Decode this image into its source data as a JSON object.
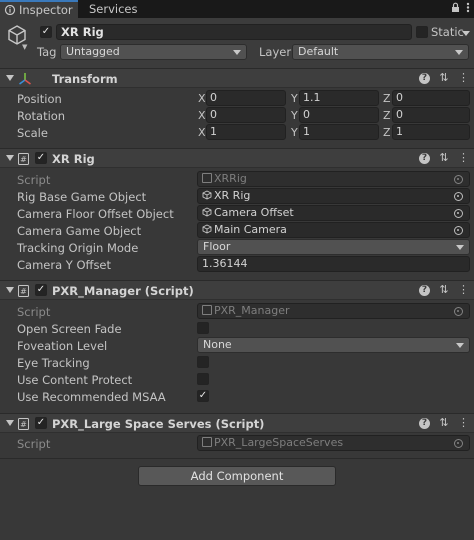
{
  "tabs": [
    {
      "label": "Inspector",
      "icon": "info-icon",
      "active": true
    },
    {
      "label": "Services",
      "active": false
    }
  ],
  "gameobject": {
    "name": "XR Rig",
    "static_label": "Static",
    "tag_label": "Tag",
    "tag_value": "Untagged",
    "layer_label": "Layer",
    "layer_value": "Default"
  },
  "transform": {
    "title": "Transform",
    "position": {
      "label": "Position",
      "x": "0",
      "y": "1.1",
      "z": "0"
    },
    "rotation": {
      "label": "Rotation",
      "x": "0",
      "y": "0",
      "z": "0"
    },
    "scale": {
      "label": "Scale",
      "x": "1",
      "y": "1",
      "z": "1"
    },
    "axis_x": "X",
    "axis_y": "Y",
    "axis_z": "Z"
  },
  "xr_rig": {
    "title": "XR Rig",
    "script_label": "Script",
    "script_value": "XRRig",
    "rig_base_label": "Rig Base Game Object",
    "rig_base_value": "XR Rig",
    "floor_offset_label": "Camera Floor Offset Object",
    "floor_offset_value": "Camera Offset",
    "camera_go_label": "Camera Game Object",
    "camera_go_value": "Main Camera",
    "tracking_mode_label": "Tracking Origin Mode",
    "tracking_mode_value": "Floor",
    "camera_y_label": "Camera Y Offset",
    "camera_y_value": "1.36144"
  },
  "pxr_manager": {
    "title": "PXR_Manager (Script)",
    "script_label": "Script",
    "script_value": "PXR_Manager",
    "open_screen_fade_label": "Open Screen Fade",
    "foveation_label": "Foveation Level",
    "foveation_value": "None",
    "eye_tracking_label": "Eye Tracking",
    "content_protect_label": "Use Content Protect",
    "msaa_label": "Use Recommended MSAA"
  },
  "pxr_large_space": {
    "title": "PXR_Large Space Serves (Script)",
    "script_label": "Script",
    "script_value": "PXR_LargeSpaceServes"
  },
  "add_component_label": "Add Component",
  "colors": {
    "accent": "#3a79bb",
    "background": "#383838",
    "field": "#2a2a2a"
  }
}
